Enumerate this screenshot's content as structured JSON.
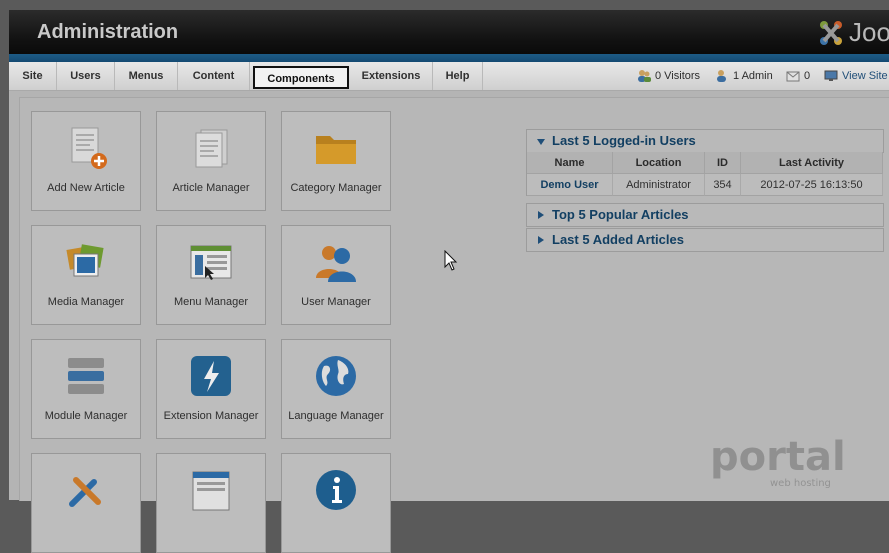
{
  "header": {
    "title": "Administration",
    "logo_text": "Joo"
  },
  "menu": {
    "items": [
      {
        "label": "Site"
      },
      {
        "label": "Users"
      },
      {
        "label": "Menus"
      },
      {
        "label": "Content"
      },
      {
        "label": "Components",
        "active": true
      },
      {
        "label": "Extensions"
      },
      {
        "label": "Help"
      }
    ]
  },
  "status": {
    "visitors": "0 Visitors",
    "admins": "1 Admin",
    "messages": "0",
    "view_site": "View Site"
  },
  "quickicons": [
    {
      "label": "Add New Article",
      "icon": "add-article-icon"
    },
    {
      "label": "Article Manager",
      "icon": "article-manager-icon"
    },
    {
      "label": "Category Manager",
      "icon": "folder-icon"
    },
    {
      "label": "Media Manager",
      "icon": "media-icon"
    },
    {
      "label": "Menu Manager",
      "icon": "menu-icon"
    },
    {
      "label": "User Manager",
      "icon": "users-icon"
    },
    {
      "label": "Module Manager",
      "icon": "module-icon"
    },
    {
      "label": "Extension Manager",
      "icon": "lightning-icon"
    },
    {
      "label": "Language Manager",
      "icon": "globe-icon"
    },
    {
      "label": "",
      "icon": "tools-icon"
    },
    {
      "label": "",
      "icon": "document-icon"
    },
    {
      "label": "",
      "icon": "info-icon"
    }
  ],
  "logged_in": {
    "title": "Last 5 Logged-in Users",
    "columns": [
      "Name",
      "Location",
      "ID",
      "Last Activity"
    ],
    "rows": [
      {
        "name": "Demo User",
        "location": "Administrator",
        "id": "354",
        "last_activity": "2012-07-25 16:13:50"
      }
    ]
  },
  "popular": {
    "title": "Top 5 Popular Articles"
  },
  "added": {
    "title": "Last 5 Added Articles"
  },
  "watermark": {
    "text": "portal",
    "subtext": "web hosting"
  },
  "colors": {
    "header_bg": "#111111",
    "stripe": "#1d5b86",
    "link": "#123f62"
  }
}
